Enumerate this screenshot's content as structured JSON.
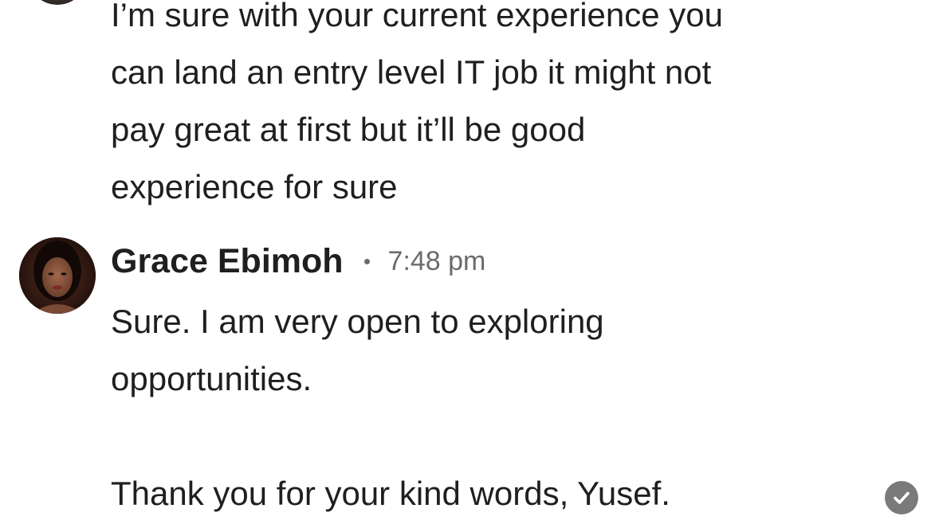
{
  "previous_message": {
    "text": "I’m sure with your current experience you\ncan land an entry level IT job it might not\npay great at first but it’ll be good\nexperience for sure"
  },
  "grace_message": {
    "sender": "Grace Ebimoh",
    "time": "7:48 pm",
    "paragraph_1": "Sure. I am very open to exploring\nopportunities.",
    "paragraph_2": "Thank you for your kind words, Yusef."
  },
  "icons": {
    "avatar_previous": "avatar-icon",
    "avatar_grace": "avatar-icon",
    "read_receipt": "check-circle-icon"
  },
  "colors": {
    "text": "#1f1f1f",
    "meta": "#6b6b6b",
    "receipt": "#7a7a7a"
  }
}
